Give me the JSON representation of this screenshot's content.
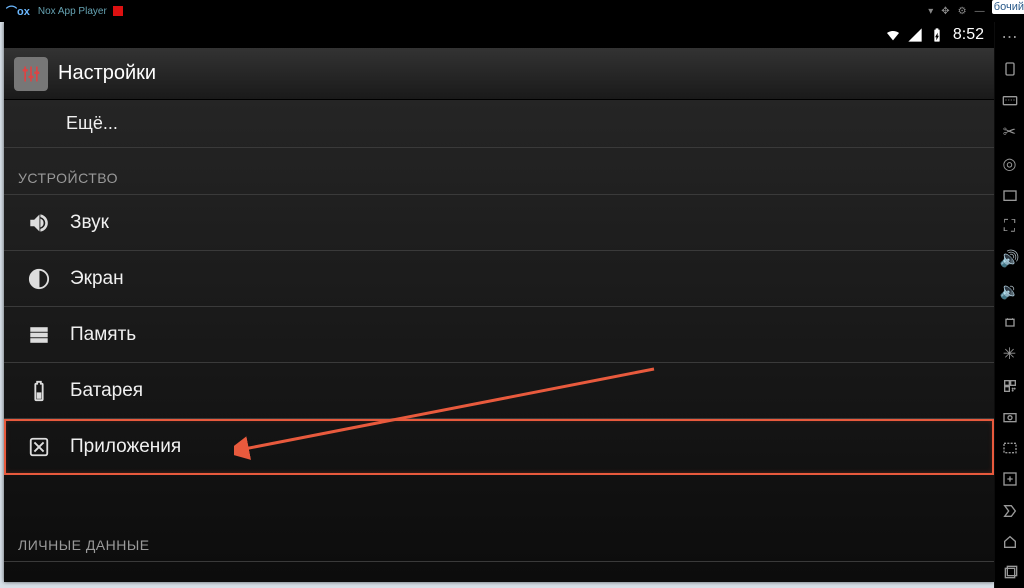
{
  "window": {
    "app_name": "Nox App Player",
    "peek_text": "бочий"
  },
  "status": {
    "clock": "8:52"
  },
  "settings": {
    "title": "Настройки",
    "more": "Ещё...",
    "category_device": "УСТРОЙСТВО",
    "items": {
      "sound": "Звук",
      "display": "Экран",
      "storage": "Память",
      "battery": "Батарея",
      "apps": "Приложения"
    },
    "category_personal": "ЛИЧНЫЕ ДАННЫЕ"
  }
}
